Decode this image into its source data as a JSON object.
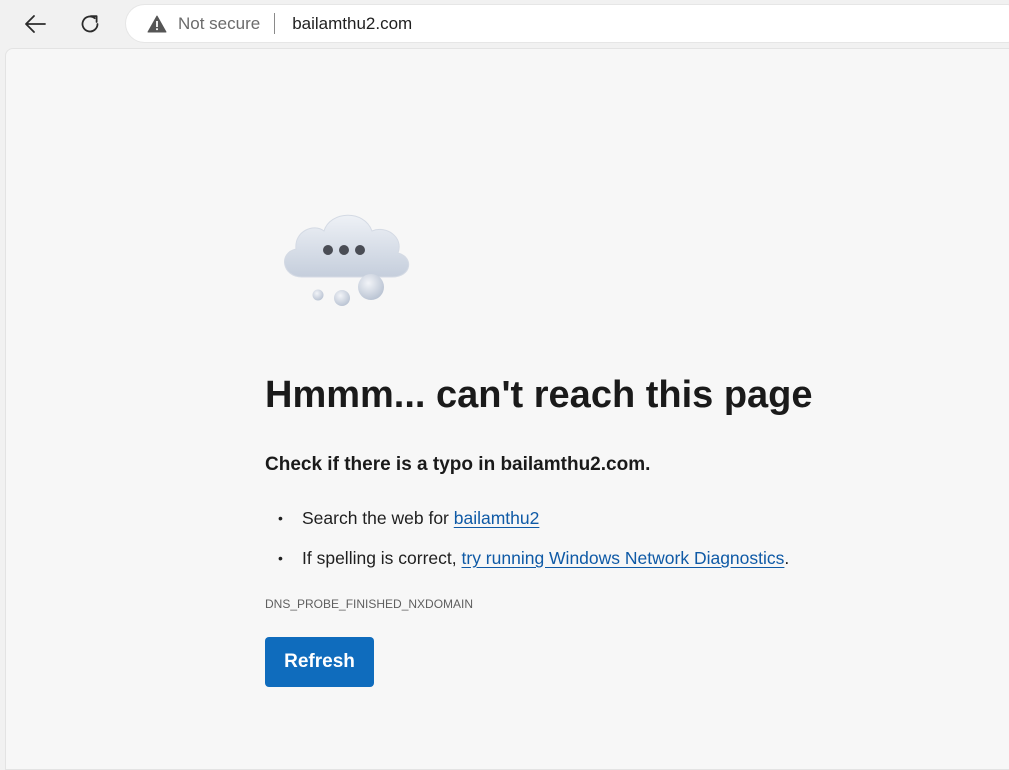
{
  "browser": {
    "back_icon": "back-arrow-icon",
    "refresh_icon": "refresh-icon",
    "address_bar": {
      "security_icon": "warning-triangle-icon",
      "security_label": "Not secure",
      "url": "bailamthu2.com"
    }
  },
  "error_page": {
    "illustration": "cloud-thinking-icon",
    "heading": "Hmmm... can't reach this page",
    "subheading": "Check if there is a typo in bailamthu2.com.",
    "suggestions": [
      {
        "prefix": "Search the web for ",
        "link_text": "bailamthu2",
        "suffix": ""
      },
      {
        "prefix": "If spelling is correct, ",
        "link_text": "try running Windows Network Diagnostics",
        "suffix": "."
      }
    ],
    "bullet": "•",
    "error_code": "DNS_PROBE_FINISHED_NXDOMAIN",
    "refresh_button_label": "Refresh"
  },
  "colors": {
    "page_background": "#f7f7f7",
    "toolbar_background": "#f1f1f1",
    "link": "#0f5aa6",
    "primary_button": "#0f6cbd"
  }
}
